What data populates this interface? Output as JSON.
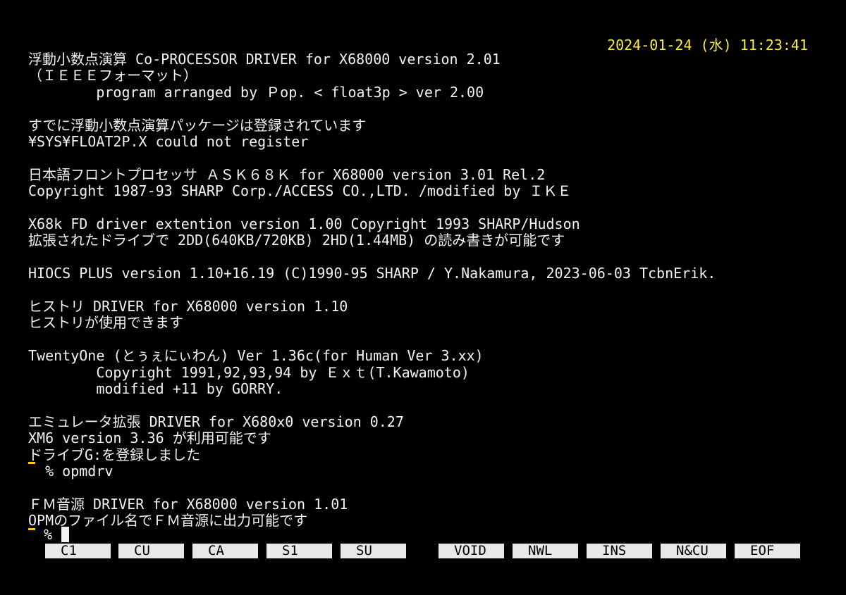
{
  "clock": "2024-01-24 (水) 11:23:41",
  "lines": [
    "浮動小数点演算 Co-PROCESSOR DRIVER for X68000 version 2.01",
    "（ＩＥＥＥフォーマット）",
    "        program arranged by Ｐop. < float3p > ver 2.00",
    "",
    "すでに浮動小数点演算パッケージは登録されています",
    "¥SYS¥FLOAT2P.X could not register",
    "",
    "日本語フロントプロセッサ ＡＳＫ６８Ｋ for X68000 version 3.01 Rel.2",
    "Copyright 1987-93 SHARP Corp./ACCESS CO.,LTD. /modified by ＩＫＥ",
    "",
    "X68k FD driver extention version 1.00 Copyright 1993 SHARP/Hudson",
    "拡張されたドライブで 2DD(640KB/720KB) 2HD(1.44MB) の読み書きが可能です",
    "",
    "HIOCS PLUS version 1.10+16.19 (C)1990-95 SHARP / Y.Nakamura, 2023-06-03 TcbnErik.",
    "",
    "ヒストリ DRIVER for X68000 version 1.10",
    "ヒストリが使用できます",
    "",
    "TwentyOne (とぅぇにぃわん) Ver 1.36c(for Human Ver 3.xx)",
    "        Copyright 1991,92,93,94 by Ｅｘｔ(T.Kawamoto)",
    "        modified +11 by GORRY.",
    "",
    "エミュレータ拡張 DRIVER for X680x0 version 0.27",
    "XM6 version 3.36 が利用可能です",
    "ドライブG:を登録しました",
    "  % opmdrv",
    "",
    "ＦＭ音源 DRIVER for X68000 version 1.01",
    "OPMのファイル名でＦＭ音源に出力可能です"
  ],
  "prompt": "%",
  "function_keys": [
    "C1",
    "CU",
    "CA",
    "S1",
    "SU",
    "VOID",
    "NWL",
    "INS",
    "N&CU",
    "EOF"
  ]
}
